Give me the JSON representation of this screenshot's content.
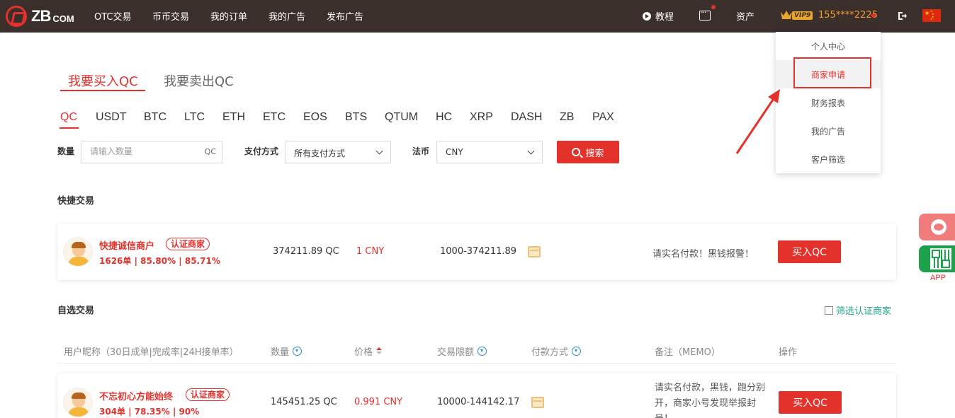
{
  "nav": {
    "logo_text": "ZB",
    "logo_sub": "COM",
    "links": [
      "OTC交易",
      "币币交易",
      "我的订单",
      "我的广告",
      "发布广告"
    ],
    "tutorial": "教程",
    "assets": "资产",
    "vip_level": "VIP9",
    "user_phone": "155****2225"
  },
  "dropdown": {
    "items": [
      "个人中心",
      "商家申请",
      "财务报表",
      "我的广告",
      "客户筛选"
    ]
  },
  "main_tabs": {
    "buy": "我要买入QC",
    "sell": "我要卖出QC"
  },
  "coins": [
    "QC",
    "USDT",
    "BTC",
    "LTC",
    "ETH",
    "ETC",
    "EOS",
    "BTS",
    "QTUM",
    "HC",
    "XRP",
    "DASH",
    "ZB",
    "PAX"
  ],
  "filters": {
    "quantity_label": "数量",
    "quantity_placeholder": "请输入数量",
    "quantity_unit": "QC",
    "payment_label": "支付方式",
    "payment_value": "所有支付方式",
    "fiat_label": "法币",
    "fiat_value": "CNY",
    "search_label": "搜索"
  },
  "quick_trade": {
    "title": "快捷交易",
    "merchant": {
      "name": "快捷诚信商户",
      "badge": "认证商家",
      "stats": "1626单 | 85.80% | 85.71%",
      "quantity": "374211.89 QC",
      "price": "1 CNY",
      "limit": "1000-374211.89",
      "memo": "请实名付款！黑钱报警！",
      "buy_label": "买入QC"
    }
  },
  "custom_trade": {
    "title": "自选交易",
    "filter_certified": "筛选认证商家",
    "headers": {
      "user": "用户昵称（30日成单|完成率|24H接单率）",
      "quantity": "数量",
      "price": "价格",
      "limit": "交易限额",
      "payment": "付款方式",
      "memo": "备注（MEMO）",
      "action": "操作"
    },
    "rows": [
      {
        "name": "不忘初心方能始终",
        "badge": "认证商家",
        "stats": "304单 | 78.35% | 90%",
        "quantity": "145451.25 QC",
        "price": "0.991 CNY",
        "limit": "10000-144142.17",
        "memo": "请实名付款，黑钱，跑分别开，商家小号发现举报封号！",
        "buy_label": "买入QC"
      }
    ]
  },
  "side": {
    "app_label": "APP"
  },
  "colors": {
    "brand_red": "#e3312c",
    "topbar": "#3b2f2c",
    "vip_orange": "#f39c2c",
    "app_green": "#1ca24b",
    "filter_teal": "#21a68d"
  }
}
